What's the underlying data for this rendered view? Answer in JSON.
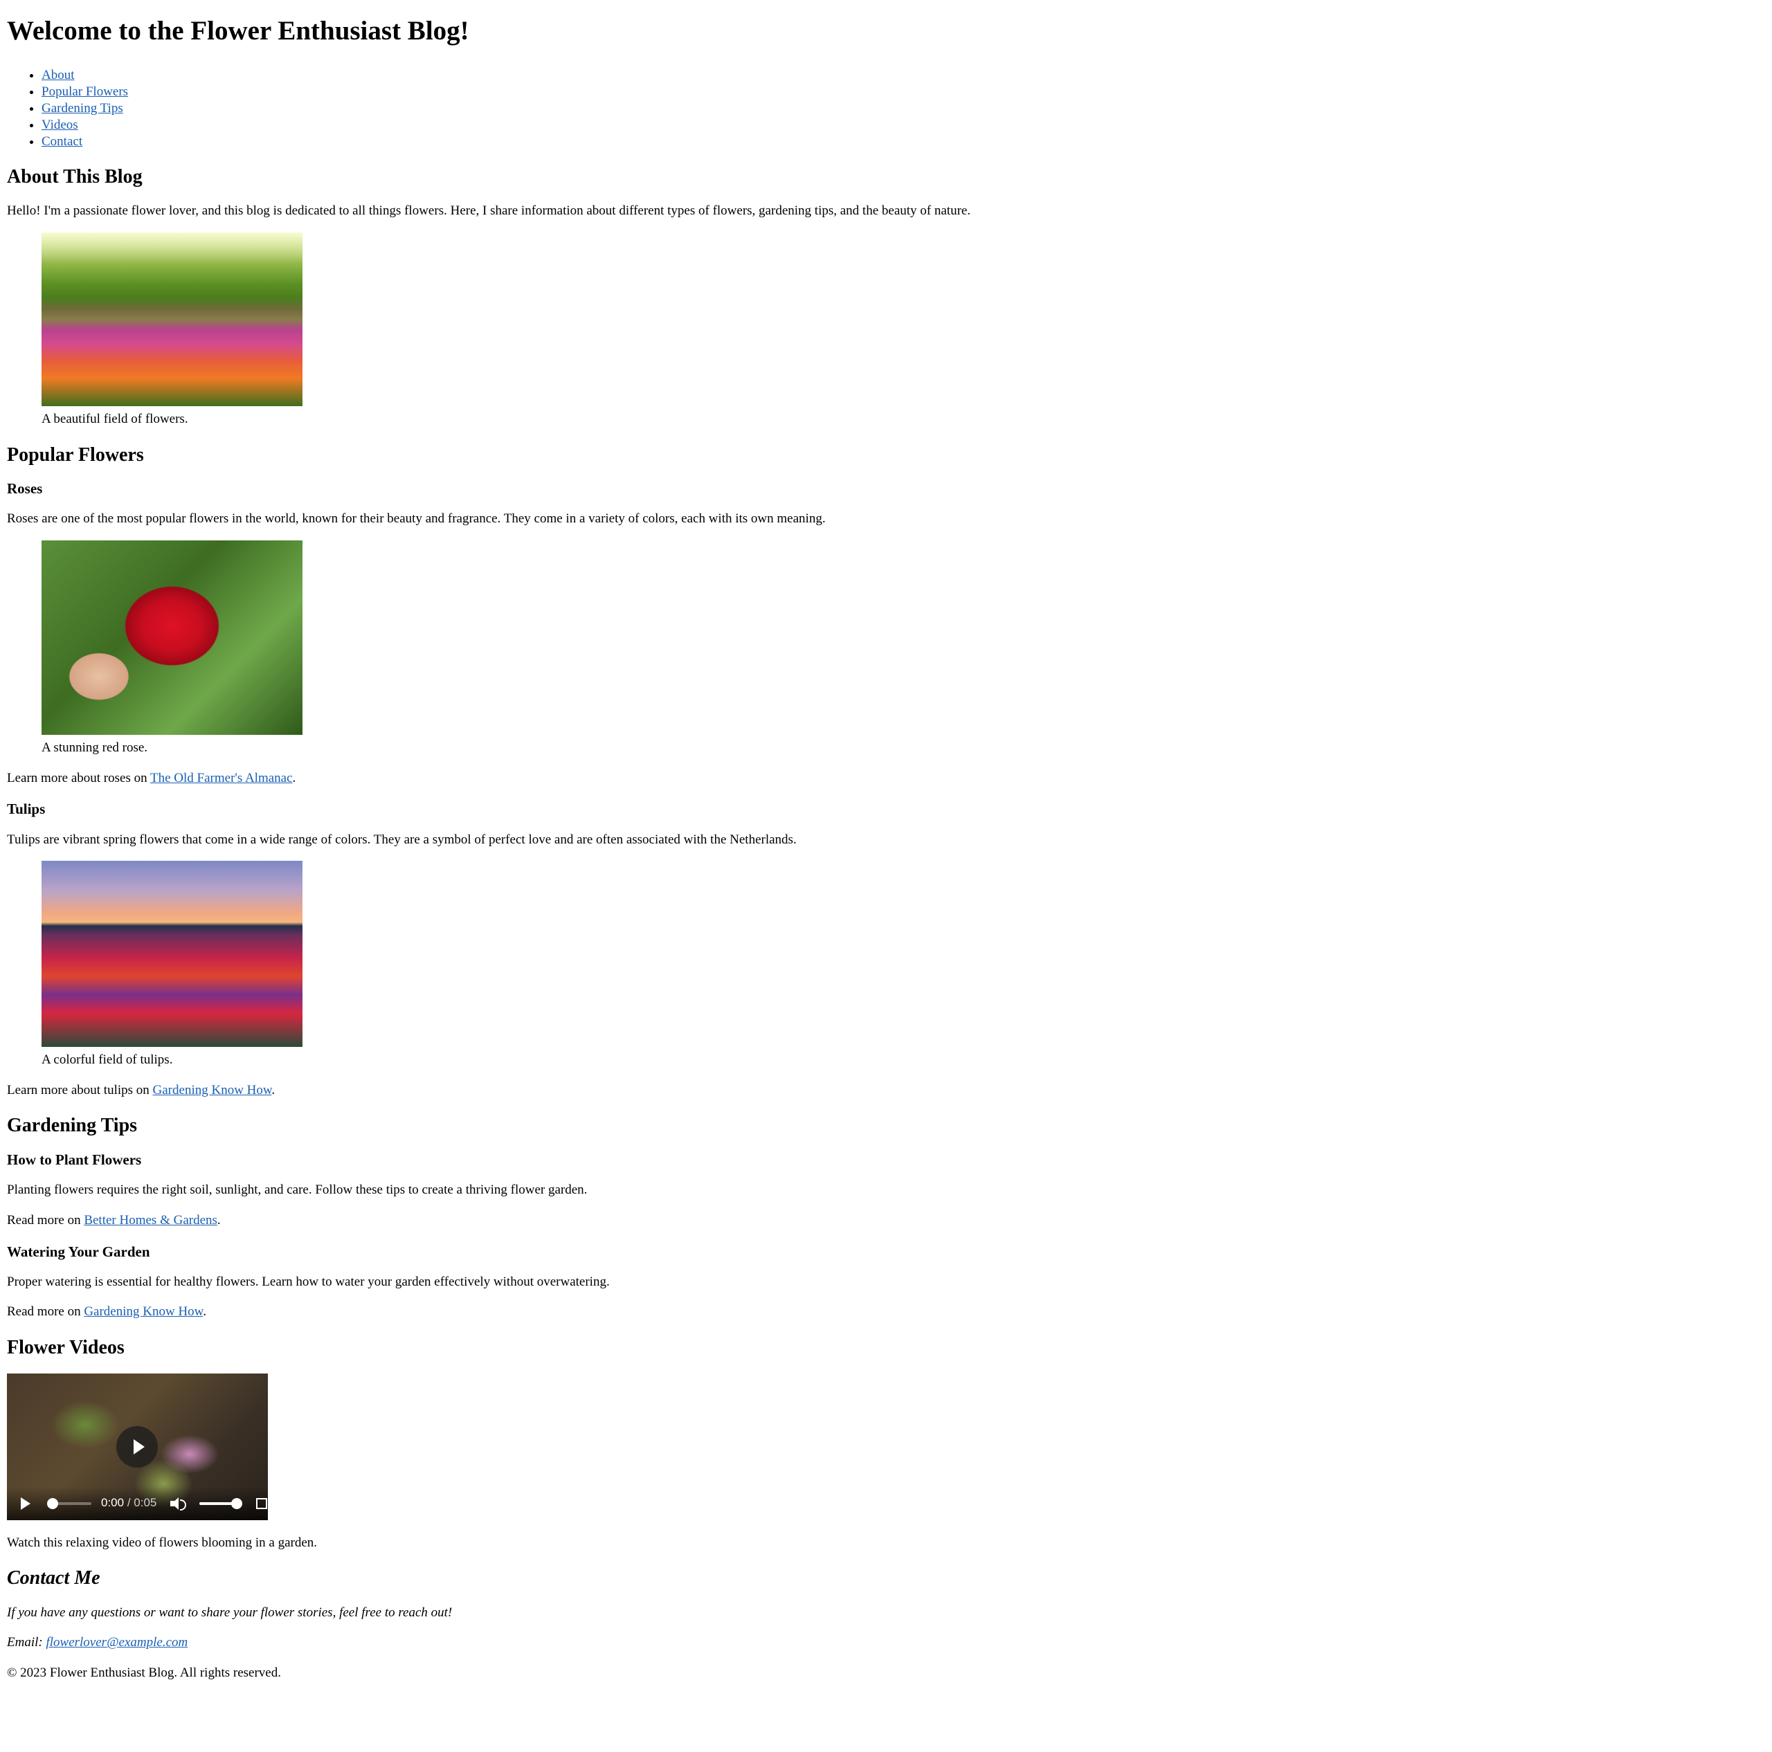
{
  "header": {
    "title": "Welcome to the Flower Enthusiast Blog!"
  },
  "nav": {
    "items": [
      {
        "label": "About"
      },
      {
        "label": "Popular Flowers"
      },
      {
        "label": "Gardening Tips"
      },
      {
        "label": "Videos"
      },
      {
        "label": "Contact"
      }
    ]
  },
  "about": {
    "heading": "About This Blog",
    "text": "Hello! I'm a passionate flower lover, and this blog is dedicated to all things flowers. Here, I share information about different types of flowers, gardening tips, and the beauty of nature.",
    "figure_caption": "A beautiful field of flowers."
  },
  "popular": {
    "heading": "Popular Flowers",
    "roses": {
      "heading": "Roses",
      "text": "Roses are one of the most popular flowers in the world, known for their beauty and fragrance. They come in a variety of colors, each with its own meaning.",
      "figure_caption": "A stunning red rose.",
      "learn_prefix": "Learn more about roses on ",
      "link_label": "The Old Farmer's Almanac",
      "learn_suffix": "."
    },
    "tulips": {
      "heading": "Tulips",
      "text": "Tulips are vibrant spring flowers that come in a wide range of colors. They are a symbol of perfect love and are often associated with the Netherlands.",
      "figure_caption": "A colorful field of tulips.",
      "learn_prefix": "Learn more about tulips on ",
      "link_label": "Gardening Know How",
      "learn_suffix": "."
    }
  },
  "tips": {
    "heading": "Gardening Tips",
    "plant": {
      "heading": "How to Plant Flowers",
      "text": "Planting flowers requires the right soil, sunlight, and care. Follow these tips to create a thriving flower garden.",
      "read_prefix": "Read more on ",
      "link_label": "Better Homes & Gardens",
      "read_suffix": "."
    },
    "water": {
      "heading": "Watering Your Garden",
      "text": "Proper watering is essential for healthy flowers. Learn how to water your garden effectively without overwatering.",
      "read_prefix": "Read more on ",
      "link_label": "Gardening Know How",
      "read_suffix": "."
    }
  },
  "videos": {
    "heading": "Flower Videos",
    "current_time": "0:00",
    "separator": " / ",
    "duration": "0:05",
    "progress_fraction": 0,
    "volume_fraction": 1,
    "caption": "Watch this relaxing video of flowers blooming in a garden."
  },
  "contact": {
    "heading": "Contact Me",
    "text": "If you have any questions or want to share your flower stories, feel free to reach out!",
    "email_label": "Email: ",
    "email": "flowerlover@example.com"
  },
  "footer": {
    "text": "© 2023 Flower Enthusiast Blog. All rights reserved."
  },
  "colors": {
    "link": "#1a5fb4",
    "text": "#000000",
    "background": "#ffffff"
  },
  "icons": [
    "play-icon",
    "volume-icon",
    "fullscreen-icon"
  ]
}
